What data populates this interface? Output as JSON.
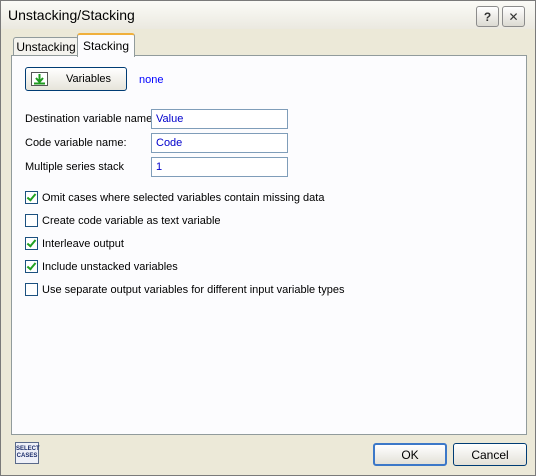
{
  "window": {
    "title": "Unstacking/Stacking"
  },
  "titlebar_buttons": {
    "help": "?",
    "close": "✕"
  },
  "tabs": [
    {
      "label": "Unstacking"
    },
    {
      "label": "Stacking"
    }
  ],
  "variables": {
    "button_label": "Variables",
    "selection": "none"
  },
  "fields": {
    "destination": {
      "label": "Destination variable name:",
      "value": "Value"
    },
    "code": {
      "label": "Code variable name:",
      "value": "Code"
    },
    "series": {
      "label": "Multiple series stack",
      "value": "1"
    }
  },
  "options": [
    {
      "label": "Omit cases where selected variables contain missing data",
      "checked": true
    },
    {
      "label": "Create code variable as text variable",
      "checked": false
    },
    {
      "label": "Interleave output",
      "checked": true
    },
    {
      "label": "Include unstacked variables",
      "checked": true
    },
    {
      "label": "Use separate output variables for different input variable types",
      "checked": false
    }
  ],
  "footer": {
    "select_cases_line1": "SELECT",
    "select_cases_line2": "CASES",
    "ok_label": "OK",
    "cancel_label": "Cancel"
  }
}
